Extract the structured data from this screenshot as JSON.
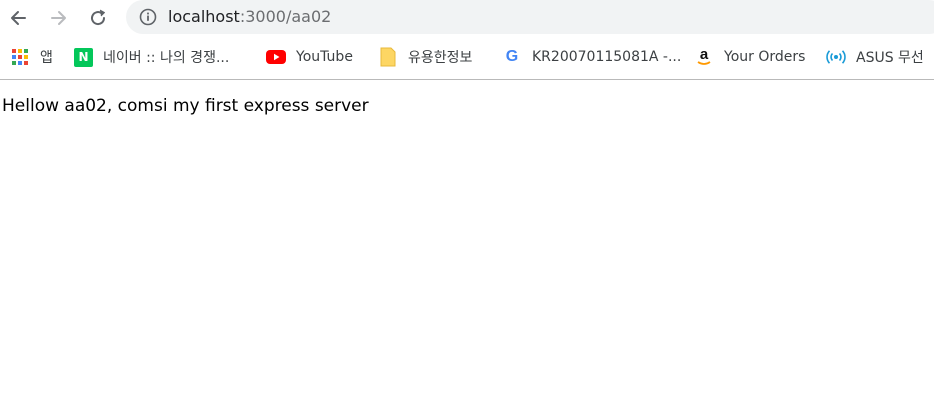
{
  "browser": {
    "url_host": "localhost",
    "url_path": ":3000/aa02"
  },
  "bookmarks": [
    {
      "icon": "apps-grid-icon",
      "label": "앱"
    },
    {
      "icon": "naver-icon",
      "icon_text": "N",
      "label": "네이버 :: 나의 경쟁..."
    },
    {
      "icon": "youtube-icon",
      "label": "YouTube"
    },
    {
      "icon": "folder-icon",
      "label": "유용한정보"
    },
    {
      "icon": "google-icon",
      "icon_text": "G",
      "label": "KR20070115081A -..."
    },
    {
      "icon": "amazon-icon",
      "icon_text": "a",
      "label": "Your Orders"
    },
    {
      "icon": "wireless-icon",
      "label": "ASUS 무선"
    }
  ],
  "page": {
    "body_text": "Hellow aa02, comsi my first express server"
  },
  "colors": {
    "omnibox_bg": "#f1f3f4",
    "naver_green": "#03c75a",
    "youtube_red": "#ff0000",
    "folder_yellow": "#fdd663",
    "google_blue": "#4285f4",
    "amazon_orange": "#ff9900",
    "asus_blue": "#1a9bd7"
  }
}
